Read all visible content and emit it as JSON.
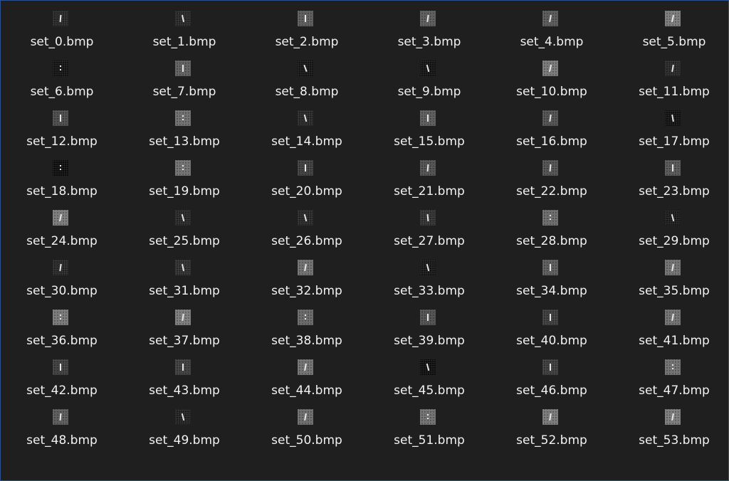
{
  "files": [
    {
      "name": "set_0.bmp",
      "tone": "#262626",
      "glyph": "line",
      "rot": 5
    },
    {
      "name": "set_1.bmp",
      "tone": "#262626",
      "glyph": "line",
      "rot": -12
    },
    {
      "name": "set_2.bmp",
      "tone": "#5a5a5a",
      "glyph": "line",
      "rot": 0
    },
    {
      "name": "set_3.bmp",
      "tone": "#5a5a5a",
      "glyph": "line",
      "rot": 8
    },
    {
      "name": "set_4.bmp",
      "tone": "#575757",
      "glyph": "line",
      "rot": 10
    },
    {
      "name": "set_5.bmp",
      "tone": "#7a7a7a",
      "glyph": "line",
      "rot": 12
    },
    {
      "name": "set_6.bmp",
      "tone": "#121212",
      "glyph": "dots",
      "rot": 0
    },
    {
      "name": "set_7.bmp",
      "tone": "#5f5f5f",
      "glyph": "line",
      "rot": 0
    },
    {
      "name": "set_8.bmp",
      "tone": "#141414",
      "glyph": "line",
      "rot": -20
    },
    {
      "name": "set_9.bmp",
      "tone": "#121212",
      "glyph": "line",
      "rot": -15
    },
    {
      "name": "set_10.bmp",
      "tone": "#777777",
      "glyph": "line",
      "rot": 12
    },
    {
      "name": "set_11.bmp",
      "tone": "#262626",
      "glyph": "line",
      "rot": 10
    },
    {
      "name": "set_12.bmp",
      "tone": "#4a4a4a",
      "glyph": "line",
      "rot": 0
    },
    {
      "name": "set_13.bmp",
      "tone": "#6d6d6d",
      "glyph": "dots",
      "rot": 0
    },
    {
      "name": "set_14.bmp",
      "tone": "#262626",
      "glyph": "line",
      "rot": -15
    },
    {
      "name": "set_15.bmp",
      "tone": "#5a5a5a",
      "glyph": "line",
      "rot": 0
    },
    {
      "name": "set_16.bmp",
      "tone": "#4f4f4f",
      "glyph": "line",
      "rot": 8
    },
    {
      "name": "set_17.bmp",
      "tone": "#101010",
      "glyph": "line",
      "rot": -10
    },
    {
      "name": "set_18.bmp",
      "tone": "#0c0c0c",
      "glyph": "dots",
      "rot": 0
    },
    {
      "name": "set_19.bmp",
      "tone": "#707070",
      "glyph": "dots",
      "rot": 0
    },
    {
      "name": "set_20.bmp",
      "tone": "#3c3c3c",
      "glyph": "line",
      "rot": 0
    },
    {
      "name": "set_21.bmp",
      "tone": "#4f4f4f",
      "glyph": "line",
      "rot": 5
    },
    {
      "name": "set_22.bmp",
      "tone": "#505050",
      "glyph": "line",
      "rot": 5
    },
    {
      "name": "set_23.bmp",
      "tone": "#555555",
      "glyph": "line",
      "rot": 0
    },
    {
      "name": "set_24.bmp",
      "tone": "#7a7a7a",
      "glyph": "line",
      "rot": 12
    },
    {
      "name": "set_25.bmp",
      "tone": "#262626",
      "glyph": "line",
      "rot": -15
    },
    {
      "name": "set_26.bmp",
      "tone": "#262626",
      "glyph": "line",
      "rot": -15
    },
    {
      "name": "set_27.bmp",
      "tone": "#303030",
      "glyph": "line",
      "rot": -5
    },
    {
      "name": "set_28.bmp",
      "tone": "#6a6a6a",
      "glyph": "dots",
      "rot": 0
    },
    {
      "name": "set_29.bmp",
      "tone": "#1a1a1a",
      "glyph": "line",
      "rot": -15
    },
    {
      "name": "set_30.bmp",
      "tone": "#262626",
      "glyph": "line",
      "rot": 8
    },
    {
      "name": "set_31.bmp",
      "tone": "#2d2d2d",
      "glyph": "line",
      "rot": -12
    },
    {
      "name": "set_32.bmp",
      "tone": "#6e6e6e",
      "glyph": "line",
      "rot": 10
    },
    {
      "name": "set_33.bmp",
      "tone": "#161616",
      "glyph": "line",
      "rot": -15
    },
    {
      "name": "set_34.bmp",
      "tone": "#5a5a5a",
      "glyph": "line",
      "rot": 0
    },
    {
      "name": "set_35.bmp",
      "tone": "#707070",
      "glyph": "line",
      "rot": 10
    },
    {
      "name": "set_36.bmp",
      "tone": "#777777",
      "glyph": "dots",
      "rot": 0
    },
    {
      "name": "set_37.bmp",
      "tone": "#7a7a7a",
      "glyph": "line",
      "rot": 8
    },
    {
      "name": "set_38.bmp",
      "tone": "#676767",
      "glyph": "dots",
      "rot": 0
    },
    {
      "name": "set_39.bmp",
      "tone": "#4f4f4f",
      "glyph": "line",
      "rot": 0
    },
    {
      "name": "set_40.bmp",
      "tone": "#3a3a3a",
      "glyph": "line",
      "rot": 0
    },
    {
      "name": "set_41.bmp",
      "tone": "#6f6f6f",
      "glyph": "line",
      "rot": 10
    },
    {
      "name": "set_42.bmp",
      "tone": "#3c3c3c",
      "glyph": "line",
      "rot": 0
    },
    {
      "name": "set_43.bmp",
      "tone": "#3c3c3c",
      "glyph": "line",
      "rot": 0
    },
    {
      "name": "set_44.bmp",
      "tone": "#707070",
      "glyph": "line",
      "rot": 10
    },
    {
      "name": "set_45.bmp",
      "tone": "#0e0e0e",
      "glyph": "line",
      "rot": -15
    },
    {
      "name": "set_46.bmp",
      "tone": "#3a3a3a",
      "glyph": "line",
      "rot": 0
    },
    {
      "name": "set_47.bmp",
      "tone": "#6f6f6f",
      "glyph": "dots",
      "rot": 0
    },
    {
      "name": "set_48.bmp",
      "tone": "#595959",
      "glyph": "line",
      "rot": 5
    },
    {
      "name": "set_49.bmp",
      "tone": "#202020",
      "glyph": "line",
      "rot": -15
    },
    {
      "name": "set_50.bmp",
      "tone": "#6b6b6b",
      "glyph": "line",
      "rot": 10
    },
    {
      "name": "set_51.bmp",
      "tone": "#6f6f6f",
      "glyph": "dots",
      "rot": 0
    },
    {
      "name": "set_52.bmp",
      "tone": "#787878",
      "glyph": "line",
      "rot": 8
    },
    {
      "name": "set_53.bmp",
      "tone": "#7a7a7a",
      "glyph": "line",
      "rot": 10
    }
  ]
}
